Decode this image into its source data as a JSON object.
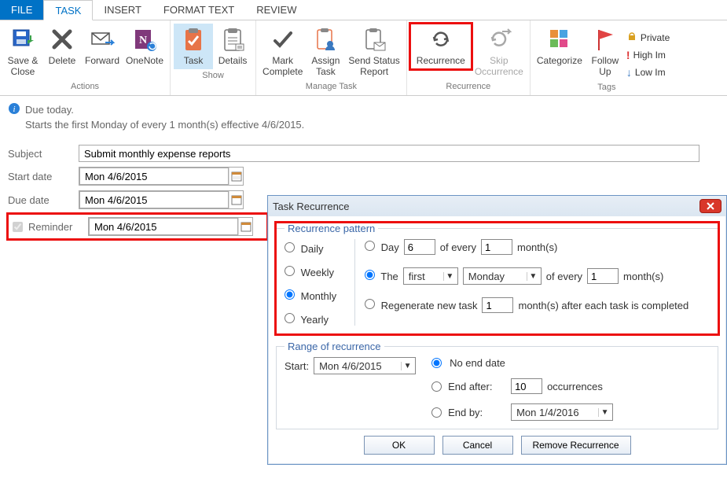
{
  "tabs": {
    "file": "FILE",
    "task": "TASK",
    "insert": "INSERT",
    "format": "FORMAT TEXT",
    "review": "REVIEW"
  },
  "ribbon": {
    "actions": {
      "label": "Actions",
      "save": "Save &\nClose",
      "delete": "Delete",
      "forward": "Forward",
      "onenote": "OneNote"
    },
    "show": {
      "label": "Show",
      "task": "Task",
      "details": "Details"
    },
    "manage": {
      "label": "Manage Task",
      "mark": "Mark\nComplete",
      "assign": "Assign\nTask",
      "status": "Send Status\nReport"
    },
    "recurrence": {
      "label": "Recurrence",
      "recurrence": "Recurrence",
      "skip": "Skip\nOccurrence"
    },
    "tags": {
      "label": "Tags",
      "categorize": "Categorize",
      "followup": "Follow\nUp",
      "private": "Private",
      "high": "High Im",
      "low": "Low Im"
    }
  },
  "info": {
    "line1": "Due today.",
    "line2": "Starts the first Monday of every 1 month(s) effective 4/6/2015."
  },
  "form": {
    "subject_label": "Subject",
    "subject_value": "Submit monthly expense reports",
    "start_label": "Start date",
    "start_value": "Mon 4/6/2015",
    "due_label": "Due date",
    "due_value": "Mon 4/6/2015",
    "reminder_label": "Reminder",
    "reminder_value": "Mon 4/6/2015"
  },
  "dialog": {
    "title": "Task Recurrence",
    "pattern_legend": "Recurrence pattern",
    "freq": {
      "daily": "Daily",
      "weekly": "Weekly",
      "monthly": "Monthly",
      "yearly": "Yearly"
    },
    "day_opt": {
      "label": "Day",
      "daynum": "6",
      "of_every": "of every",
      "monthnum": "1",
      "months": "month(s)"
    },
    "the_opt": {
      "label": "The",
      "ord": "first",
      "weekday": "Monday",
      "of_every": "of every",
      "monthnum": "1",
      "months": "month(s)"
    },
    "regen": {
      "label": "Regenerate new task",
      "num": "1",
      "after": "month(s) after each task is completed"
    },
    "range_legend": "Range of recurrence",
    "range": {
      "start_label": "Start:",
      "start_value": "Mon 4/6/2015",
      "noend": "No end date",
      "endafter": "End after:",
      "occ_value": "10",
      "occurrences": "occurrences",
      "endby": "End by:",
      "endby_value": "Mon 1/4/2016"
    },
    "buttons": {
      "ok": "OK",
      "cancel": "Cancel",
      "remove": "Remove Recurrence"
    }
  }
}
